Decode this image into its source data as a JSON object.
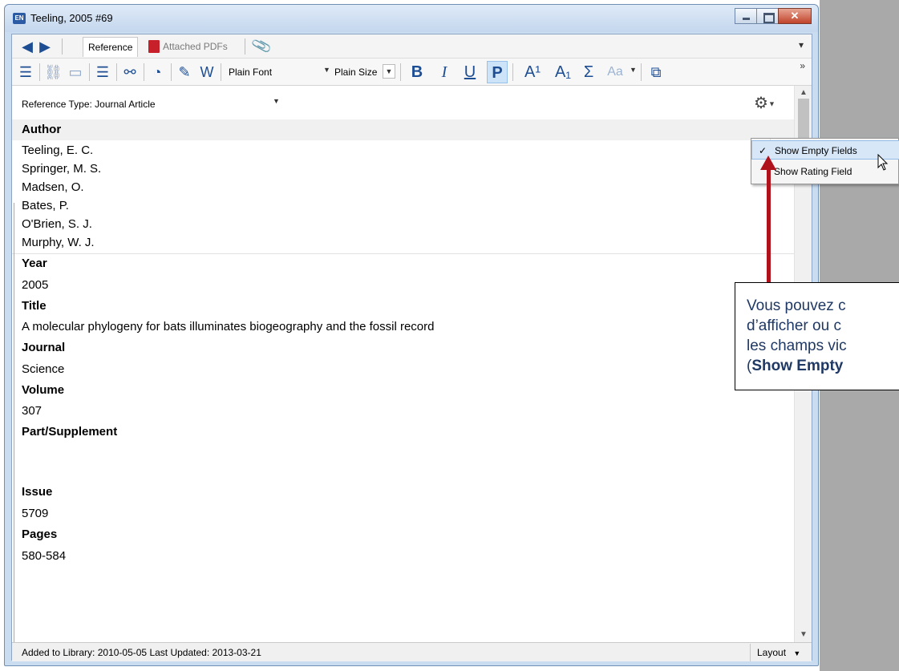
{
  "window": {
    "title": "Teeling, 2005 #69",
    "app_badge": "EN"
  },
  "nav": {
    "back_icon": "arrow-left-icon",
    "forward_icon": "arrow-right-icon",
    "tab_reference": "Reference",
    "tab_pdfs": "Attached PDFs",
    "more": "▾"
  },
  "toolbar": {
    "font": "Plain Font",
    "size": "Plain Size",
    "bold": "B",
    "italic": "I",
    "underline": "U",
    "plain": "P",
    "superscript": "A¹",
    "subscript": "A₁",
    "symbol": "Σ",
    "case": "Aa",
    "more": "»"
  },
  "ref": {
    "type_label": "Reference Type:  Journal Article",
    "fields": {
      "author_label": "Author",
      "authors": [
        "Teeling, E. C.",
        "Springer, M. S.",
        "Madsen, O.",
        "Bates, P.",
        "O'Brien, S. J.",
        "Murphy, W. J."
      ],
      "year_label": "Year",
      "year": "2005",
      "title_label": "Title",
      "title": "A molecular phylogeny for bats illuminates biogeography and the fossil record",
      "journal_label": "Journal",
      "journal": "Science",
      "volume_label": "Volume",
      "volume": "307",
      "part_label": "Part/Supplement",
      "part": "",
      "issue_label": "Issue",
      "issue": "5709",
      "pages_label": "Pages",
      "pages": "580-584"
    }
  },
  "menu": {
    "show_empty": "Show Empty Fields",
    "show_rating": "Show Rating Field",
    "checked": true
  },
  "status": {
    "text": "Added to Library: 2010-05-05   Last Updated: 2013-03-21",
    "layout": "Layout"
  },
  "callout": {
    "line1": "Vous pouvez c",
    "line2": "d’afficher ou c",
    "line3": "les champs vic",
    "line4_open": "(",
    "line4_bold": "Show Empty"
  },
  "colors": {
    "accent_blue": "#1d4e93",
    "arrow_red": "#b0121b",
    "callout_text": "#1f3864"
  }
}
